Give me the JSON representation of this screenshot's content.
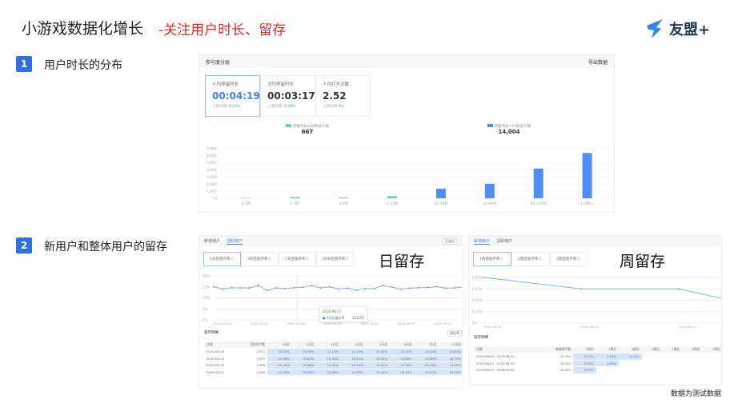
{
  "title": "小游戏数据化增长",
  "subtitle": "-关注用户时长、留存",
  "logo": {
    "text": "友盟+",
    "colors": {
      "bird": "#2e8be8",
      "text": "#1f3550"
    }
  },
  "steps": [
    {
      "num": "1",
      "label": "用户时长的分布"
    },
    {
      "num": "2",
      "label": "新用户和整体用户的留存"
    }
  ],
  "footer": "数据为测试数据",
  "engagement": {
    "header": "参与度分层",
    "export": "导出数据",
    "cards": [
      {
        "label": "人均停留时长",
        "value": "00:04:19",
        "compare": "上周同期",
        "delta": "-0.14%"
      },
      {
        "label": "次均停留时长",
        "value": "00:03:17",
        "compare": "上周同期",
        "delta": "-0.08%"
      },
      {
        "label": "人均打开次数",
        "value": "2.52",
        "compare": "上周同期",
        "delta": "0%"
      }
    ],
    "legend": [
      {
        "label": "停留时长≤10秒总人数",
        "total": "667",
        "color": "#5fd3cf"
      },
      {
        "label": "停留时长>10秒总人数",
        "total": "14,004",
        "color": "#4f8ef5"
      }
    ]
  },
  "chart_data": [
    {
      "type": "bar",
      "categories": [
        "0-1秒",
        "1-3秒",
        "3-5秒",
        "5-10秒",
        "10-30秒",
        "30-60秒",
        "60-120秒",
        "120秒+"
      ],
      "values": [
        60,
        180,
        120,
        307,
        1350,
        2050,
        4200,
        6404
      ],
      "series_of_bar": [
        0,
        0,
        0,
        0,
        1,
        1,
        1,
        1
      ],
      "yticks": [
        "0",
        "1,000",
        "2,000",
        "3,000",
        "4,000",
        "5,000",
        "6,000",
        "7,000"
      ],
      "ylim": [
        0,
        7000
      ],
      "grid": true
    },
    {
      "type": "line",
      "title": "",
      "yticks": [
        "0%",
        "5%",
        "10%",
        "15%",
        "20%"
      ],
      "ylim": [
        0,
        20
      ],
      "xticks": [
        "2020-08-18",
        "2020-08-22",
        "2020-08-26",
        "2020-08-30",
        "2020-09-03",
        "2020-09-07",
        "2020-09-11"
      ],
      "values": [
        15,
        14,
        14.6,
        14.5,
        14.5,
        15.6,
        13.4,
        14.5,
        14.2,
        14.6,
        14.8,
        15.6,
        14.5,
        15,
        14,
        14.4,
        13.5,
        14.2,
        14.2,
        15.7,
        14.8,
        14,
        14.4,
        14.6,
        14.7,
        15.1,
        14.4,
        14.5,
        15
      ],
      "tooltip": {
        "date": "2020-08-27",
        "series": "1天后留存率",
        "value": "15.63%"
      }
    },
    {
      "type": "line",
      "yticks": [
        "0%",
        "0.01%",
        "0.02%",
        "0.03%",
        "0.04%"
      ],
      "ylim": [
        0,
        0.04
      ],
      "xticks": [
        "2020-08-16",
        "2020-08-23",
        "2020-08-30"
      ],
      "values": [
        0.04,
        0.03,
        0.03,
        0.011
      ]
    }
  ],
  "daily": {
    "big_label": "日留存",
    "tabs": [
      "新增用户",
      "活跃用户"
    ],
    "active_tab": 1,
    "unit_select": "天留存",
    "metric_cards": [
      "1天后留存率",
      "3天后留存率",
      "7天后留存率",
      "30天后留存率"
    ],
    "table_title": "留存明细",
    "table_button": "留存率",
    "columns": [
      "日期",
      "活跃用户数",
      "1天后",
      "2天后",
      "3天后",
      "4天后",
      "5天后",
      "6天后",
      "7天后",
      "14天后"
    ],
    "rows": [
      [
        "2020-08-18",
        "2,972",
        "15.00%",
        "15.99%",
        "15.01%",
        "15.14%",
        "15.61%",
        "15.32%",
        "15.04%",
        "14.67%"
      ],
      [
        "2020-08-19",
        "2,977",
        "14.98%",
        "15.62%",
        "15.43%",
        "15.52%",
        "15.43%",
        "15.89%",
        "15.89%",
        "16.19%"
      ],
      [
        "2020-08-20",
        "2,969",
        "15.70%",
        "15.96%",
        "15.30%",
        "15.39%",
        "15.33%",
        "15.35%",
        "15.29%",
        "15.09%"
      ],
      [
        "2020-08-21",
        "2,969",
        "15.56%",
        "15.96%",
        "15.36%",
        "14.99%",
        "15.44%",
        "15.93%",
        "15.07%",
        "15.56%"
      ]
    ]
  },
  "weekly": {
    "big_label": "周留存",
    "tabs": [
      "新增用户",
      "活跃用户"
    ],
    "active_tab": 0,
    "metric_cards": [
      "1周后留存率",
      "2周后留存率",
      "3周后留存率"
    ],
    "table_title": "留存明细",
    "columns": [
      "日期",
      "新增用户数",
      "1周后",
      "2周后",
      "3周后",
      "4周后",
      "5周后",
      "6周后",
      "7周后"
    ],
    "rows": [
      [
        "2020/08/16 - 2020/08/22",
        "14,084",
        "0.03%",
        "0.03%",
        "0.03%",
        "",
        "",
        "",
        ""
      ],
      [
        "2020/08/23 - 2020/08/29",
        "14,083",
        "0.03%",
        "0.03%",
        "",
        "",
        "",
        "",
        ""
      ],
      [
        "2020/08/30 - 2020/09/05",
        "14,083",
        "0.03%",
        "",
        "",
        "",
        "",
        "",
        ""
      ]
    ]
  }
}
